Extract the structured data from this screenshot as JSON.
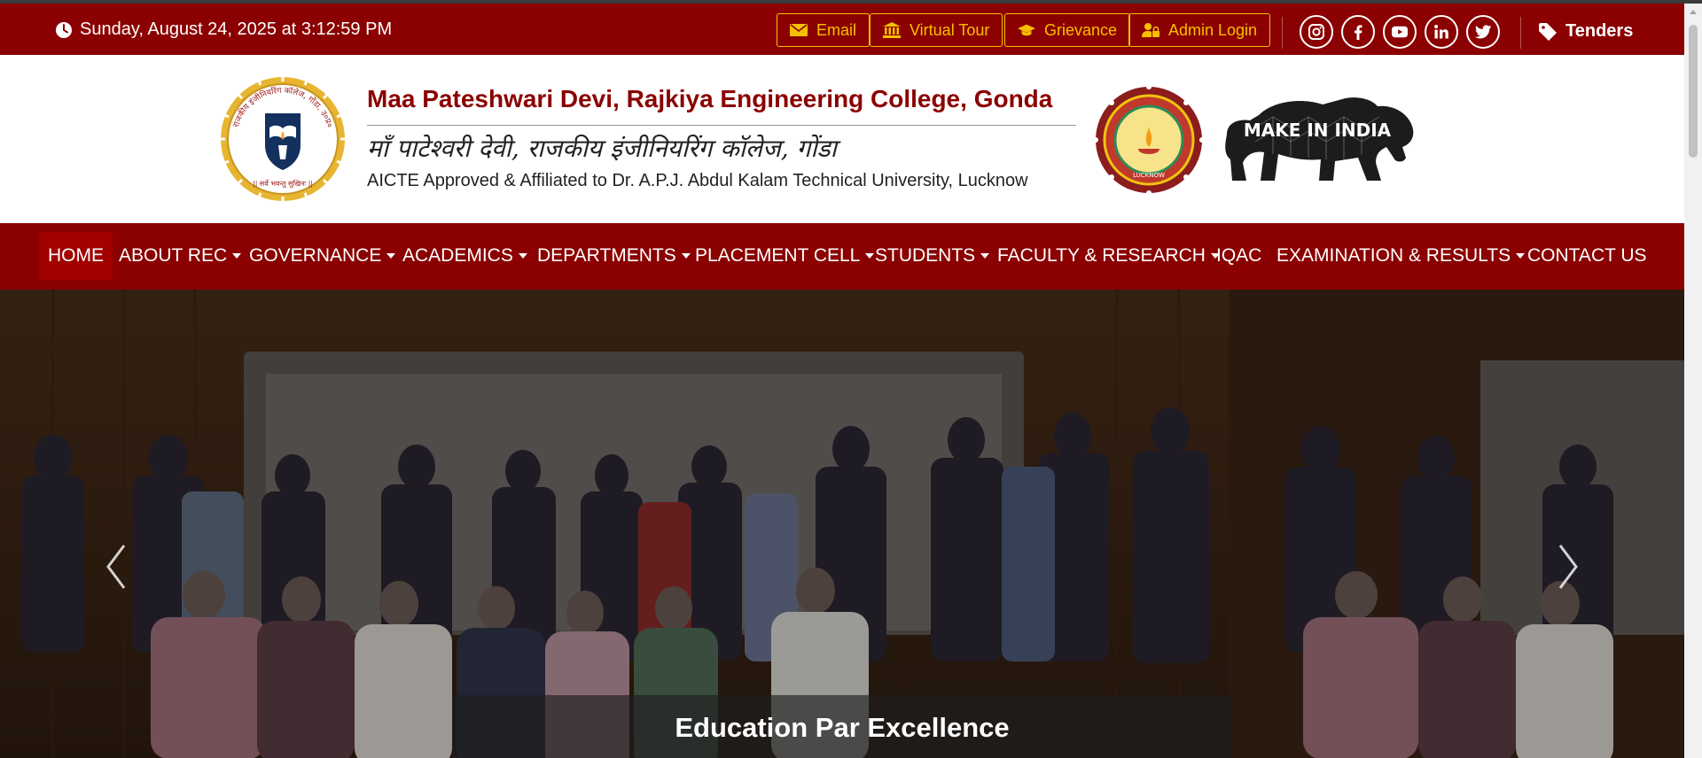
{
  "topbar": {
    "datetime": "Sunday, August 24, 2025 at 3:12:59 PM",
    "links": [
      {
        "label": "Email",
        "icon": "envelope-icon"
      },
      {
        "label": "Virtual Tour",
        "icon": "museum-icon"
      },
      {
        "label": "Grievance",
        "icon": "graduation-cap-icon"
      },
      {
        "label": "Admin Login",
        "icon": "user-lock-icon"
      }
    ],
    "social": [
      "instagram-icon",
      "facebook-icon",
      "youtube-icon",
      "linkedin-icon",
      "twitter-icon"
    ],
    "tenders_label": "Tenders",
    "colors": {
      "bar": "#8b0000",
      "accent": "#f6c000"
    }
  },
  "header": {
    "college_name_en": "Maa Pateshwari Devi, Rajkiya Engineering College, Gonda",
    "college_name_hi": "माँ पाटेश्वरी देवी, राजकीय इंजीनियरिंग कॉलेज, गोंडा",
    "affiliation": "AICTE Approved & Affiliated to Dr. A.P.J. Abdul Kalam Technical University, Lucknow",
    "seal": {
      "motto": "|| सर्वे भवन्तु सुखिनः ||",
      "ring_text": "राजकीय इंजीनियरिंग कॉलेज, गोंडा, उ०प्र०"
    },
    "aktu_logo_text": "LUCKNOW",
    "make_in_india_text": "MAKE IN INDIA"
  },
  "nav": {
    "items": [
      {
        "label": "HOME",
        "dropdown": false,
        "active": true
      },
      {
        "label": "ABOUT REC",
        "dropdown": true
      },
      {
        "label": "GOVERNANCE",
        "dropdown": true
      },
      {
        "label": "ACADEMICS",
        "dropdown": true
      },
      {
        "label": "DEPARTMENTS",
        "dropdown": true
      },
      {
        "label": "PLACEMENT CELL",
        "dropdown": true
      },
      {
        "label": "STUDENTS",
        "dropdown": true
      },
      {
        "label": "FACULTY & RESEARCH",
        "dropdown": true
      },
      {
        "label": "IQAC",
        "dropdown": false
      },
      {
        "label": "EXAMINATION & RESULTS",
        "dropdown": true
      },
      {
        "label": "CONTACT US",
        "dropdown": false
      }
    ]
  },
  "hero": {
    "caption": "Education Par Excellence",
    "prev_icon": "chevron-left-icon",
    "next_icon": "chevron-right-icon"
  }
}
